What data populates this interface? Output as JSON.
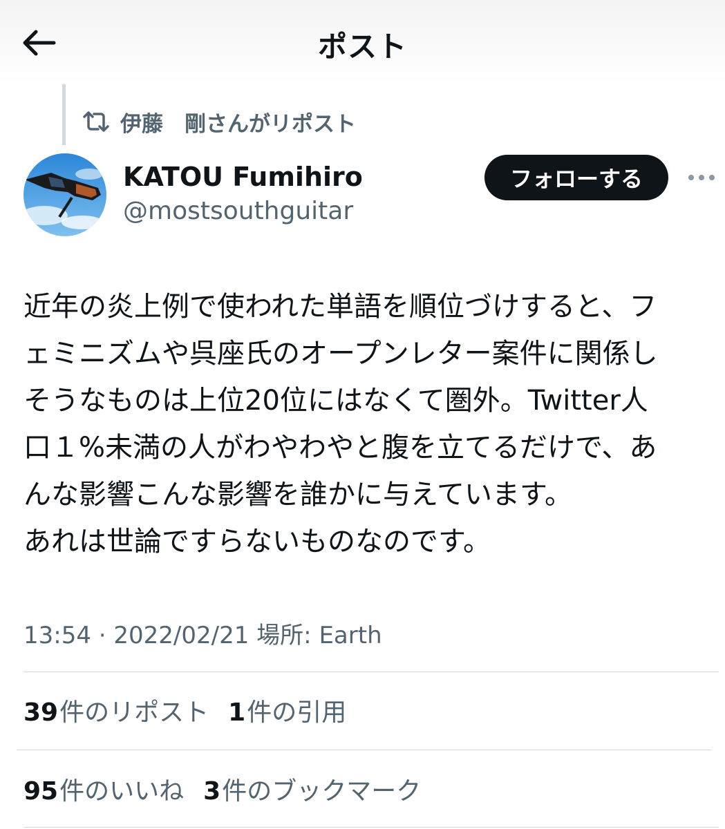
{
  "header": {
    "title": "ポスト"
  },
  "repost": {
    "text": "伊藤　剛さんがリポスト"
  },
  "author": {
    "display_name": "KATOU Fumihiro",
    "handle": "@mostsouthguitar",
    "follow_label": "フォローする"
  },
  "tweet": {
    "lines": [
      "近年の炎上例で使われた単語を順位づけすると、フ",
      "ェミニズムや呉座氏のオープンレター案件に関係し",
      "そうなものは上位20位にはなくて圏外。Twitter人",
      "口１%未満の人がわやわやと腹を立てるだけで、あ",
      "んな影響こんな影響を誰かに与えています。",
      "あれは世論ですらないものなのです。"
    ]
  },
  "meta": {
    "text": "13:54 · 2022/02/21 場所: Earth"
  },
  "stats": {
    "reposts": {
      "count": "39",
      "label": "件のリポスト"
    },
    "quotes": {
      "count": "1",
      "label": "件の引用"
    },
    "likes": {
      "count": "95",
      "label": "件のいいね"
    },
    "bookmarks": {
      "count": "3",
      "label": "件のブックマーク"
    }
  },
  "colors": {
    "text": "#0f1419",
    "secondary": "#536471",
    "divider": "#cfd9de",
    "follow_bg": "#0f1419"
  },
  "icons": {
    "back": "back-arrow-icon",
    "repost": "repost-icon",
    "more": "more-dots-icon"
  }
}
